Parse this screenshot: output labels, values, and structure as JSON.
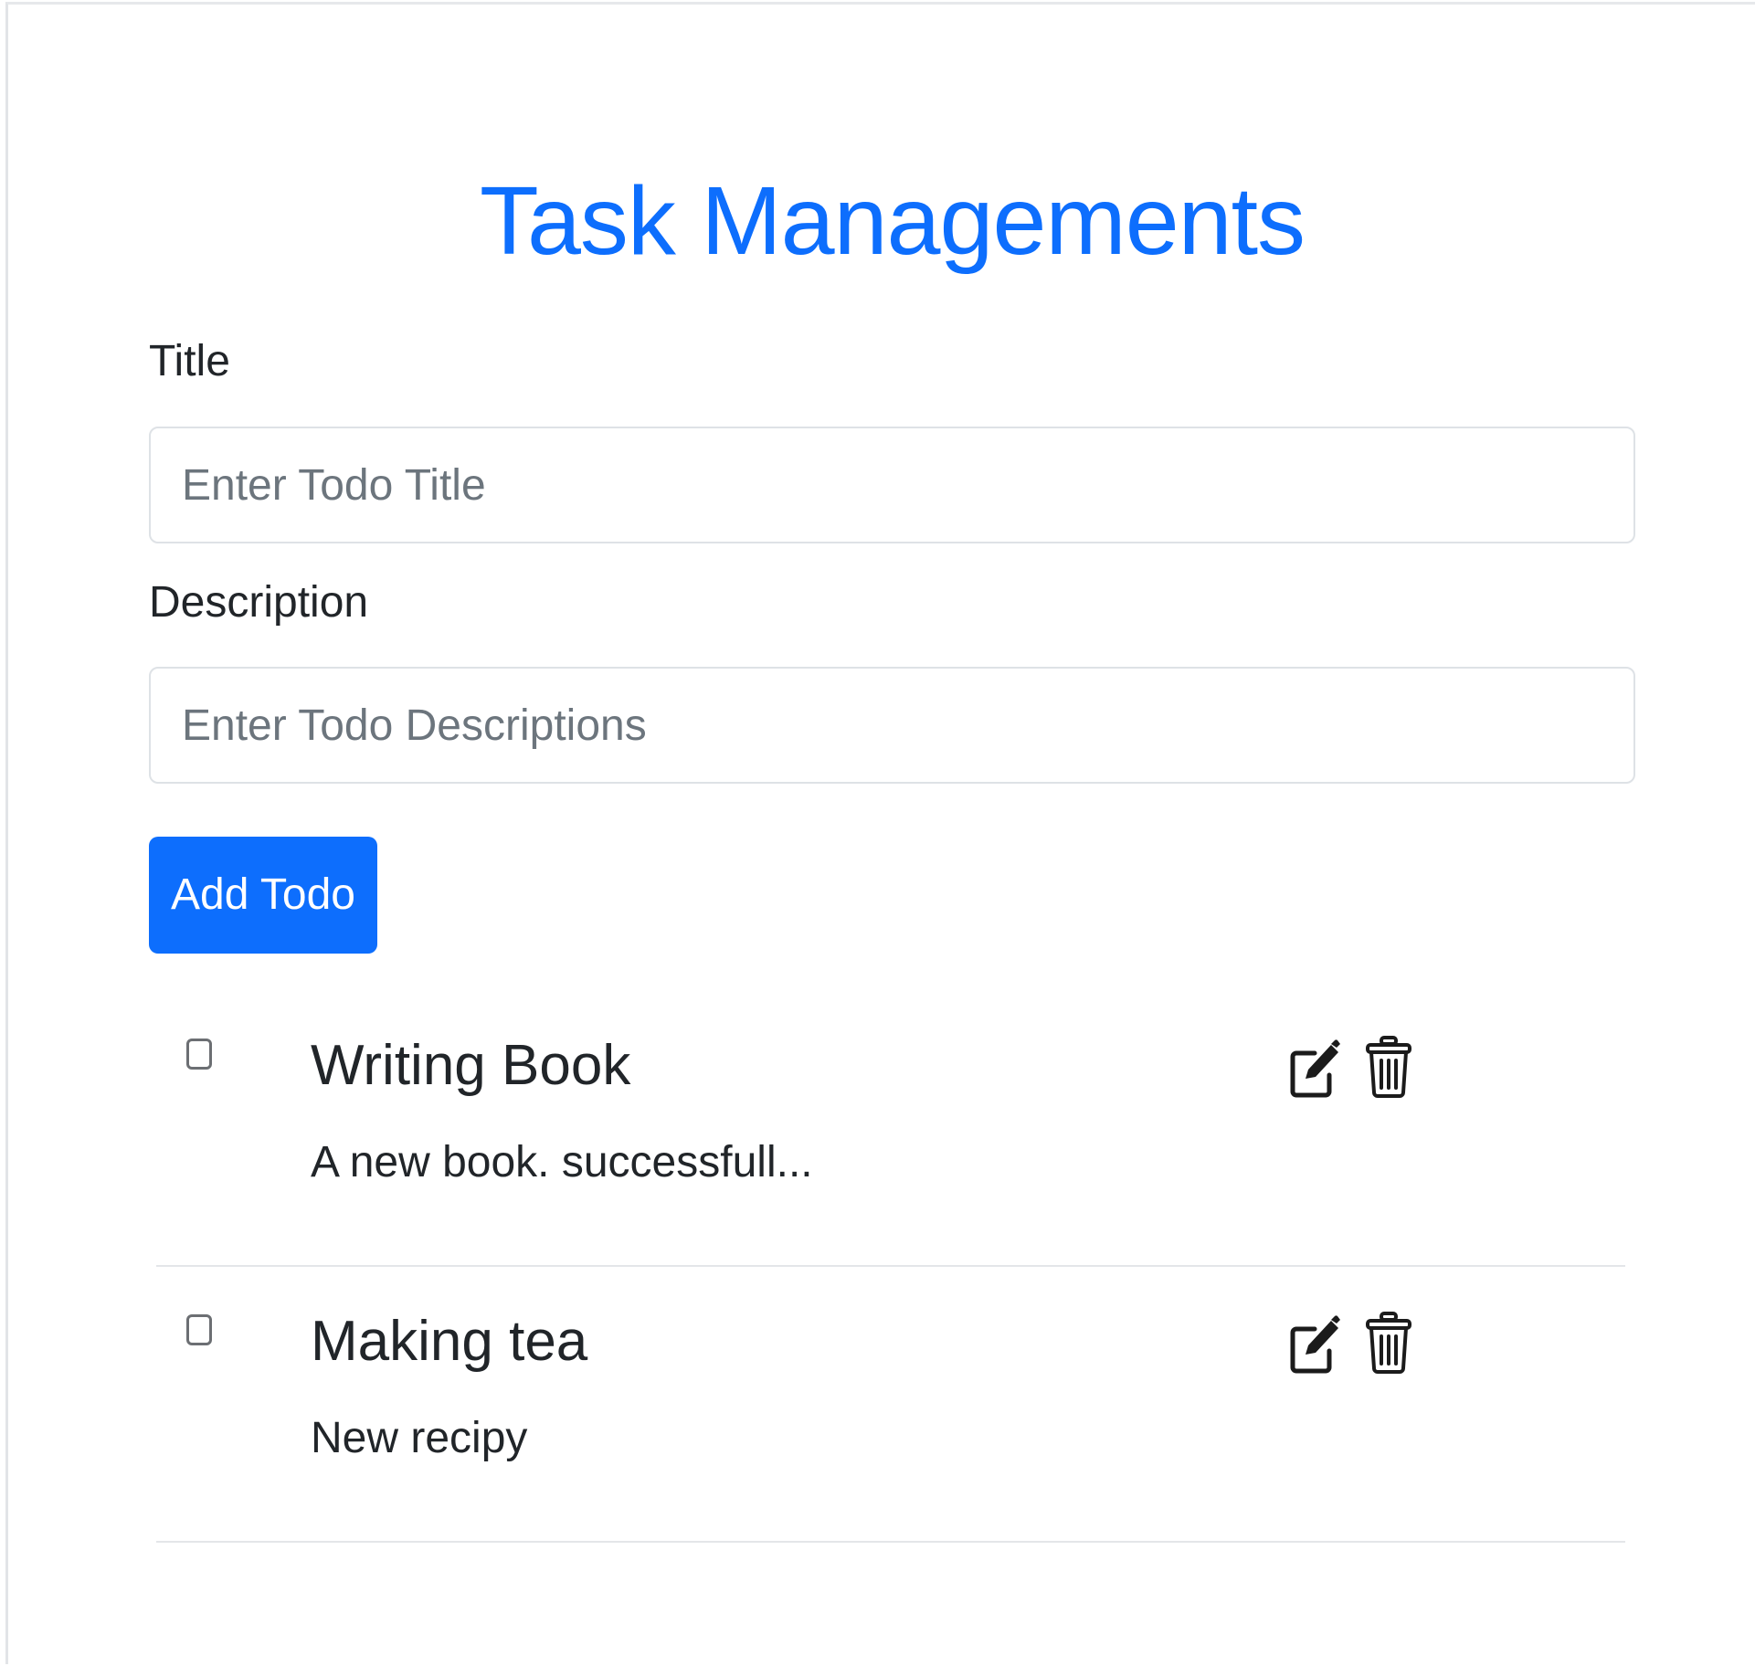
{
  "header": {
    "title": "Task Managements"
  },
  "form": {
    "title_label": "Title",
    "title_placeholder": "Enter Todo Title",
    "title_value": "",
    "description_label": "Description",
    "description_placeholder": "Enter Todo Descriptions",
    "description_value": "",
    "submit_label": "Add Todo"
  },
  "todos": [
    {
      "title": "Writing Book",
      "description": "A new book. successfull...",
      "completed": false,
      "actions": [
        "edit-icon",
        "trash-icon"
      ]
    },
    {
      "title": "Making tea",
      "description": "New recipy",
      "completed": false,
      "actions": [
        "edit-icon",
        "trash-icon"
      ]
    }
  ],
  "colors": {
    "accent": "#0d6efd",
    "text": "#212529",
    "placeholder": "#6c757d",
    "border": "#dee2e6"
  }
}
